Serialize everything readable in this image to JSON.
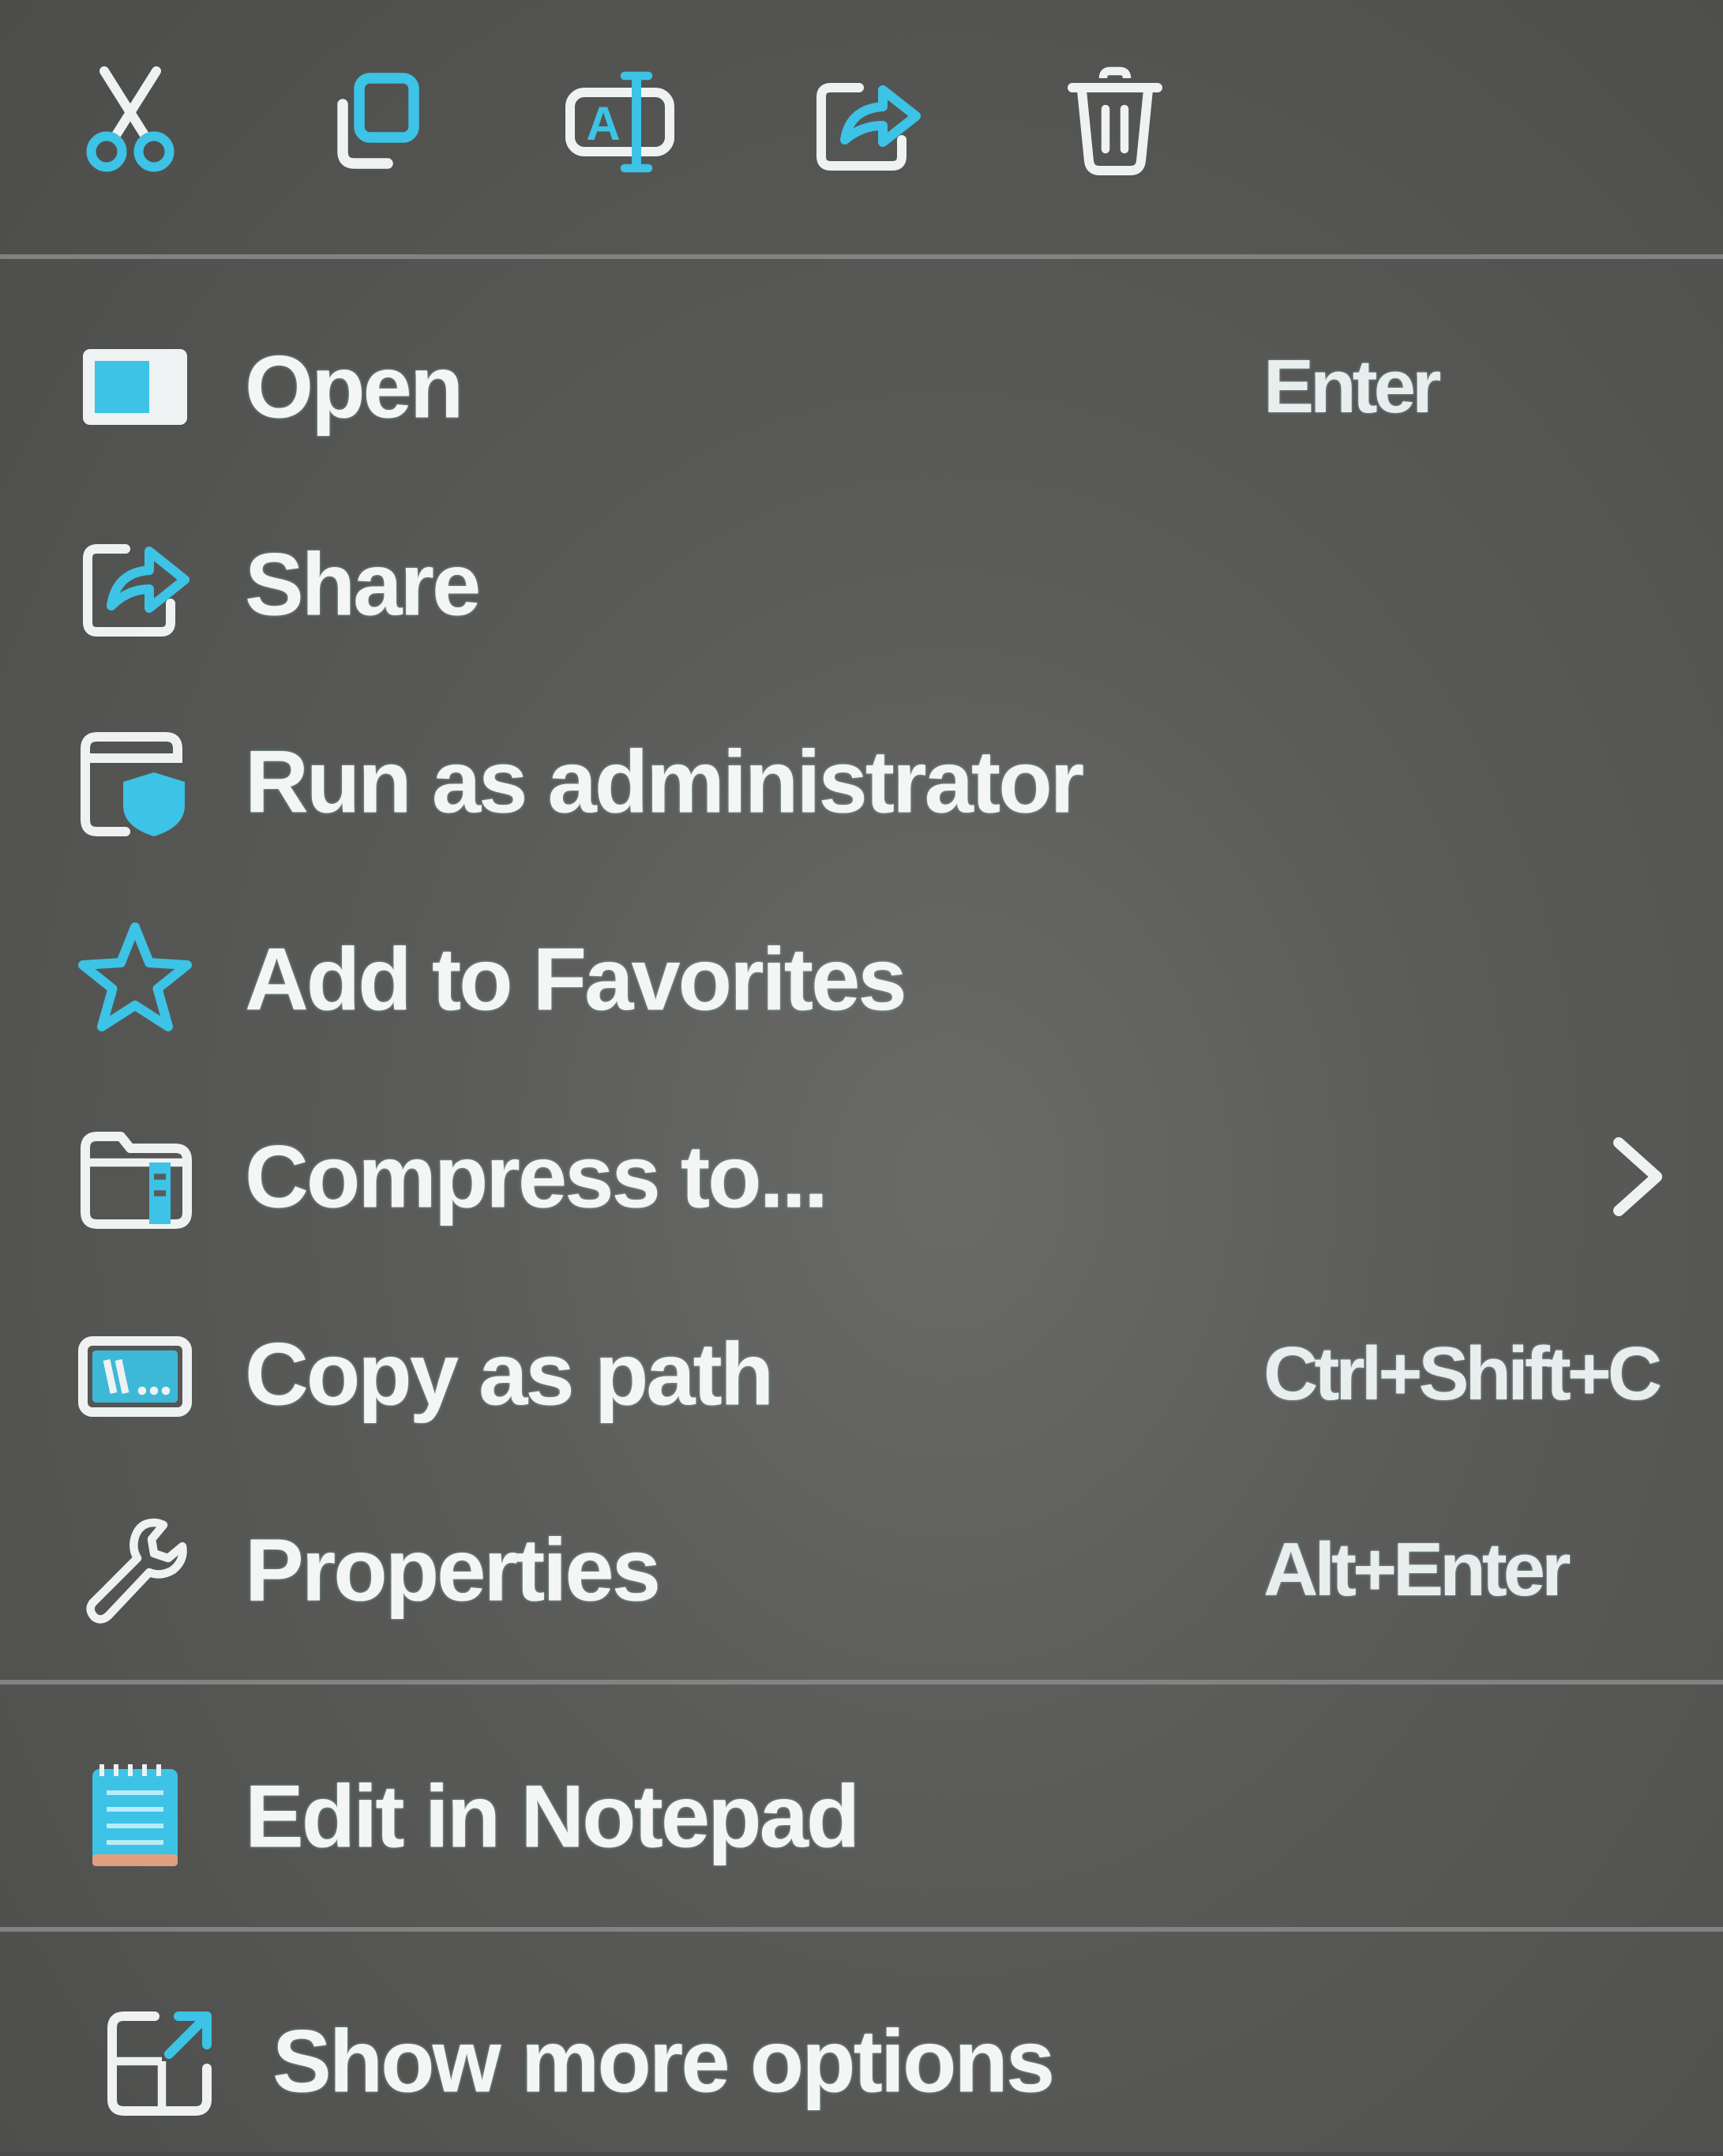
{
  "toolbar": {
    "buttons": [
      {
        "name": "cut-button",
        "icon": "scissors-icon"
      },
      {
        "name": "copy-button",
        "icon": "copy-icon"
      },
      {
        "name": "rename-button",
        "icon": "rename-icon"
      },
      {
        "name": "share-button",
        "icon": "share-icon"
      },
      {
        "name": "delete-button",
        "icon": "trash-icon"
      }
    ]
  },
  "items": [
    {
      "label": "Open",
      "shortcut": "Enter",
      "icon": "open-app-icon"
    },
    {
      "label": "Share",
      "shortcut": "",
      "icon": "share-icon"
    },
    {
      "label": "Run as administrator",
      "shortcut": "",
      "icon": "shield-window-icon"
    },
    {
      "label": "Add to Favorites",
      "shortcut": "",
      "icon": "star-icon"
    },
    {
      "label": "Compress to...",
      "shortcut": "",
      "icon": "zip-folder-icon",
      "submenu": true
    },
    {
      "label": "Copy as path",
      "shortcut": "Ctrl+Shift+C",
      "icon": "path-icon"
    },
    {
      "label": "Properties",
      "shortcut": "Alt+Enter",
      "icon": "wrench-icon"
    },
    {
      "label": "Edit in Notepad",
      "shortcut": "",
      "icon": "notepad-icon"
    },
    {
      "label": "Show more options",
      "shortcut": "",
      "icon": "expand-icon"
    }
  ],
  "colors": {
    "accent": "#3cc3e6",
    "icon_outline": "#eef2f2",
    "background": "#5a5b59"
  }
}
